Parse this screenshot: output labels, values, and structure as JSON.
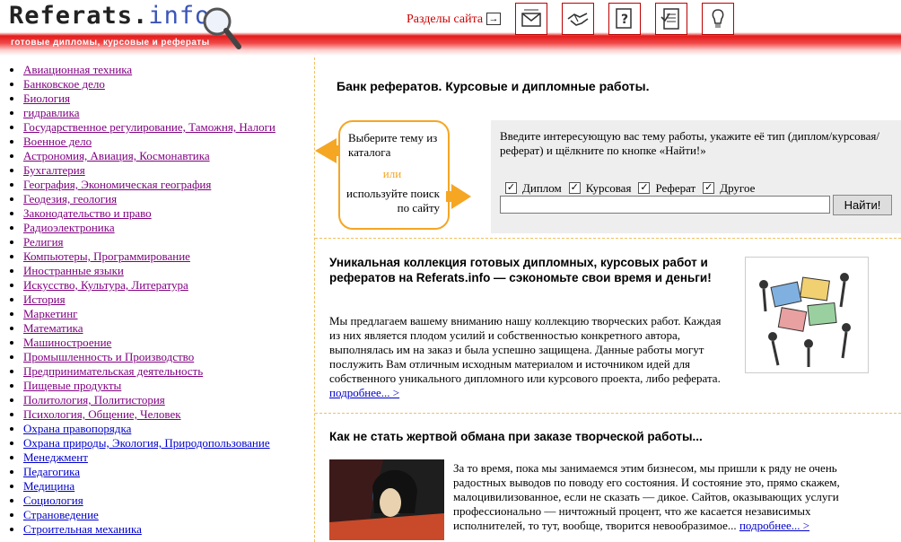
{
  "header": {
    "logo_main": "Referats.",
    "logo_tld": "info",
    "logo_subtitle": "готовые дипломы, курсовые и рефераты",
    "sections_label": "Разделы сайта",
    "nav_icons": [
      "mail-icon",
      "handshake-icon",
      "question-icon",
      "document-icon",
      "lightbulb-icon"
    ]
  },
  "catalog": [
    "Авиационная техника",
    "Банковское дело",
    "Биология",
    "гидравлика",
    "Государственное регулирование, Таможня, Налоги",
    "Военное дело",
    "Астрономия, Авиация, Космонавтика",
    "Бухгалтерия",
    "География, Экономическая география",
    "Геодезия, геология",
    "Законодательство и право",
    "Радиоэлектроника",
    "Религия",
    "Компьютеры, Программирование",
    "Иностранные языки",
    "Искусство, Культура, Литература",
    "История",
    "Маркетинг",
    "Математика",
    "Машиностроение",
    "Промышленность и Производство",
    "Предпринимательская деятельность",
    "Пищевые продукты",
    "Политология, Политистория",
    "Психология, Общение, Человек",
    "Охрана правопорядка",
    "Охрана природы, Экология, Природопользование",
    "Менеджмент",
    "Педагогика",
    "Медицина",
    "Социология",
    "Страноведение",
    "Строительная механика"
  ],
  "main": {
    "bank_title": "Банк рефератов. Курсовые и дипломные работы.",
    "choose_line1": "Выберите тему из каталога",
    "choose_or": "или",
    "choose_line2": "используйте поиск по сайту",
    "search_hint": "Введите интересующую вас тему работы, укажите её тип (диплом/курсовая/реферат) и щёлкните по кнопке «Найти!»",
    "checkboxes": [
      {
        "label": "Диплом",
        "checked": true
      },
      {
        "label": "Курсовая",
        "checked": true
      },
      {
        "label": "Реферат",
        "checked": true
      },
      {
        "label": "Другое",
        "checked": true
      }
    ],
    "search_value": "",
    "search_button": "Найти!",
    "article1_title": "Уникальная коллекция готовых дипломных, курсовых работ и рефератов на Referats.info — сэкономьте свои время и деньги!",
    "article1_body": "Мы предлагаем вашему вниманию нашу коллекцию творческих работ. Каждая из них является плодом усилий и собственностью конкретного автора, выполнялась им на заказ и была успешно защищена. Данные работы могут послужить Вам отличным исходным материалом и источником идей для собственного уникального дипломного или курсового проекта, либо реферата.",
    "more_label": "подробнее... >",
    "article2_title": "Как не стать жертвой обмана при заказе творческой работы...",
    "article2_body": "За то время, пока мы занимаемся этим бизнесом, мы пришли к ряду не очень радостных выводов по поводу его состояния. И состояние это, прямо скажем, малоцивилизованное, если не сказать — дикое. Сайтов, оказывающих услуги профессионально — ничтожный процент, что же касается независимых исполнителей, то тут, вообще, творится невообразимое...",
    "more_label2": "подробнее... >"
  },
  "colors": {
    "accent": "#e31a1a",
    "orange": "#f5a623",
    "link": "#0000cc",
    "visited": "#800080"
  }
}
